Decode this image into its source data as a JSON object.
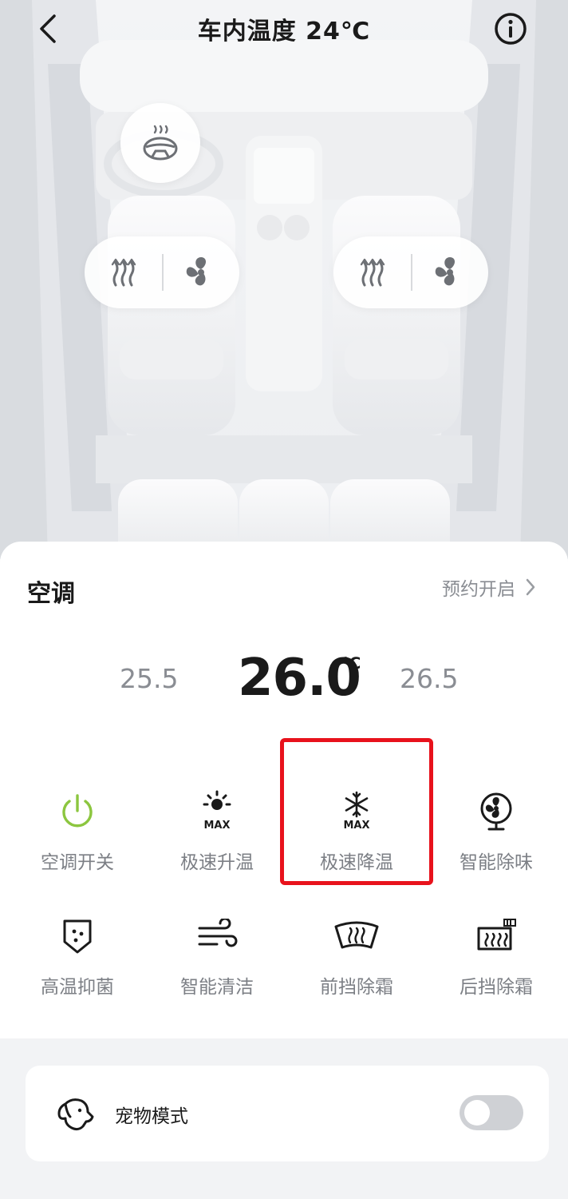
{
  "header": {
    "title": "车内温度 24℃"
  },
  "icons": {
    "back": "chevron-left-icon",
    "info": "info-circle-icon",
    "steering_heat": "steering-wheel-heat-icon",
    "seat_heat": "seat-heat-icon",
    "seat_vent": "fan-icon"
  },
  "ac": {
    "title": "空调",
    "schedule_label": "预约开启",
    "temp_lower": "25.5",
    "temp_current": "26.0",
    "temp_unit": "℃",
    "temp_higher": "26.5",
    "functions": [
      {
        "label": "空调开关",
        "icon": "power-icon"
      },
      {
        "label": "极速升温",
        "icon": "sun-max-icon"
      },
      {
        "label": "极速降温",
        "icon": "snowflake-max-icon"
      },
      {
        "label": "智能除味",
        "icon": "fan-deodorize-icon"
      },
      {
        "label": "高温抑菌",
        "icon": "shield-sterilize-icon"
      },
      {
        "label": "智能清洁",
        "icon": "wind-clean-icon"
      },
      {
        "label": "前挡除霜",
        "icon": "front-defrost-icon"
      },
      {
        "label": "后挡除霜",
        "icon": "rear-defrost-icon"
      }
    ]
  },
  "pet_mode": {
    "label": "宠物模式",
    "enabled": false,
    "icon": "dog-icon"
  },
  "colors": {
    "power_green": "#8cc63f",
    "highlight_red": "#e8121c"
  }
}
